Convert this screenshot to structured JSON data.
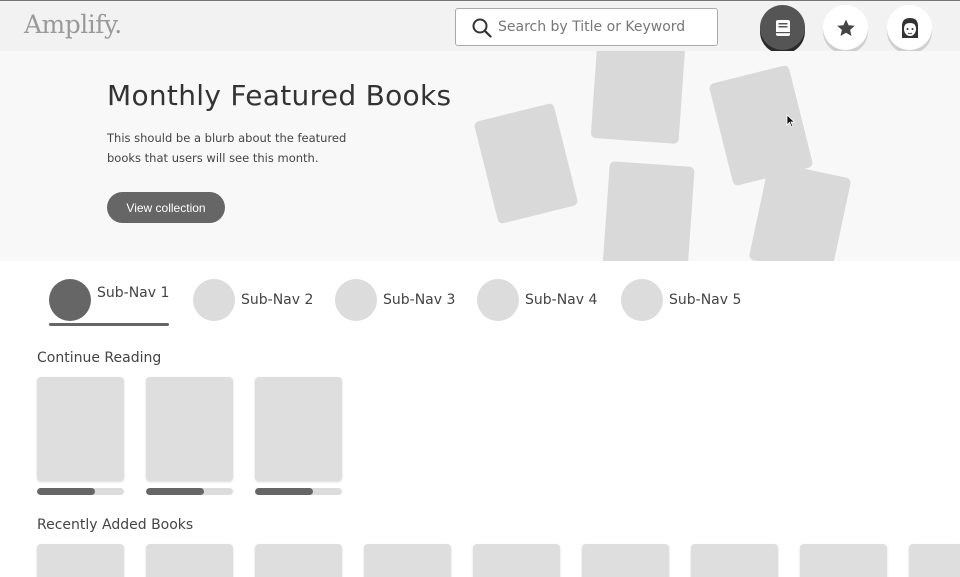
{
  "header": {
    "logo": "Amplify.",
    "search_placeholder": "Search by Title or Keyword",
    "buttons": [
      {
        "icon": "book-icon",
        "active": true
      },
      {
        "icon": "star-icon",
        "active": false
      },
      {
        "icon": "avatar-icon",
        "active": false
      }
    ]
  },
  "hero": {
    "title": "Monthly Featured Books",
    "blurb": "This should be a blurb about the featured books that users will see this month.",
    "button_label": "View collection"
  },
  "subnav": {
    "items": [
      {
        "label": "Sub-Nav 1",
        "active": true
      },
      {
        "label": "Sub-Nav 2",
        "active": false
      },
      {
        "label": "Sub-Nav 3",
        "active": false
      },
      {
        "label": "Sub-Nav 4",
        "active": false
      },
      {
        "label": "Sub-Nav 5",
        "active": false
      }
    ]
  },
  "continue_reading": {
    "title": "Continue Reading",
    "books": [
      {
        "progress": 0.67
      },
      {
        "progress": 0.67
      },
      {
        "progress": 0.67
      }
    ]
  },
  "recently_added": {
    "title": "Recently Added Books"
  },
  "colors": {
    "accent": "#666666",
    "placeholder": "#d9d9d9",
    "header_bg": "#f2f2f2"
  }
}
